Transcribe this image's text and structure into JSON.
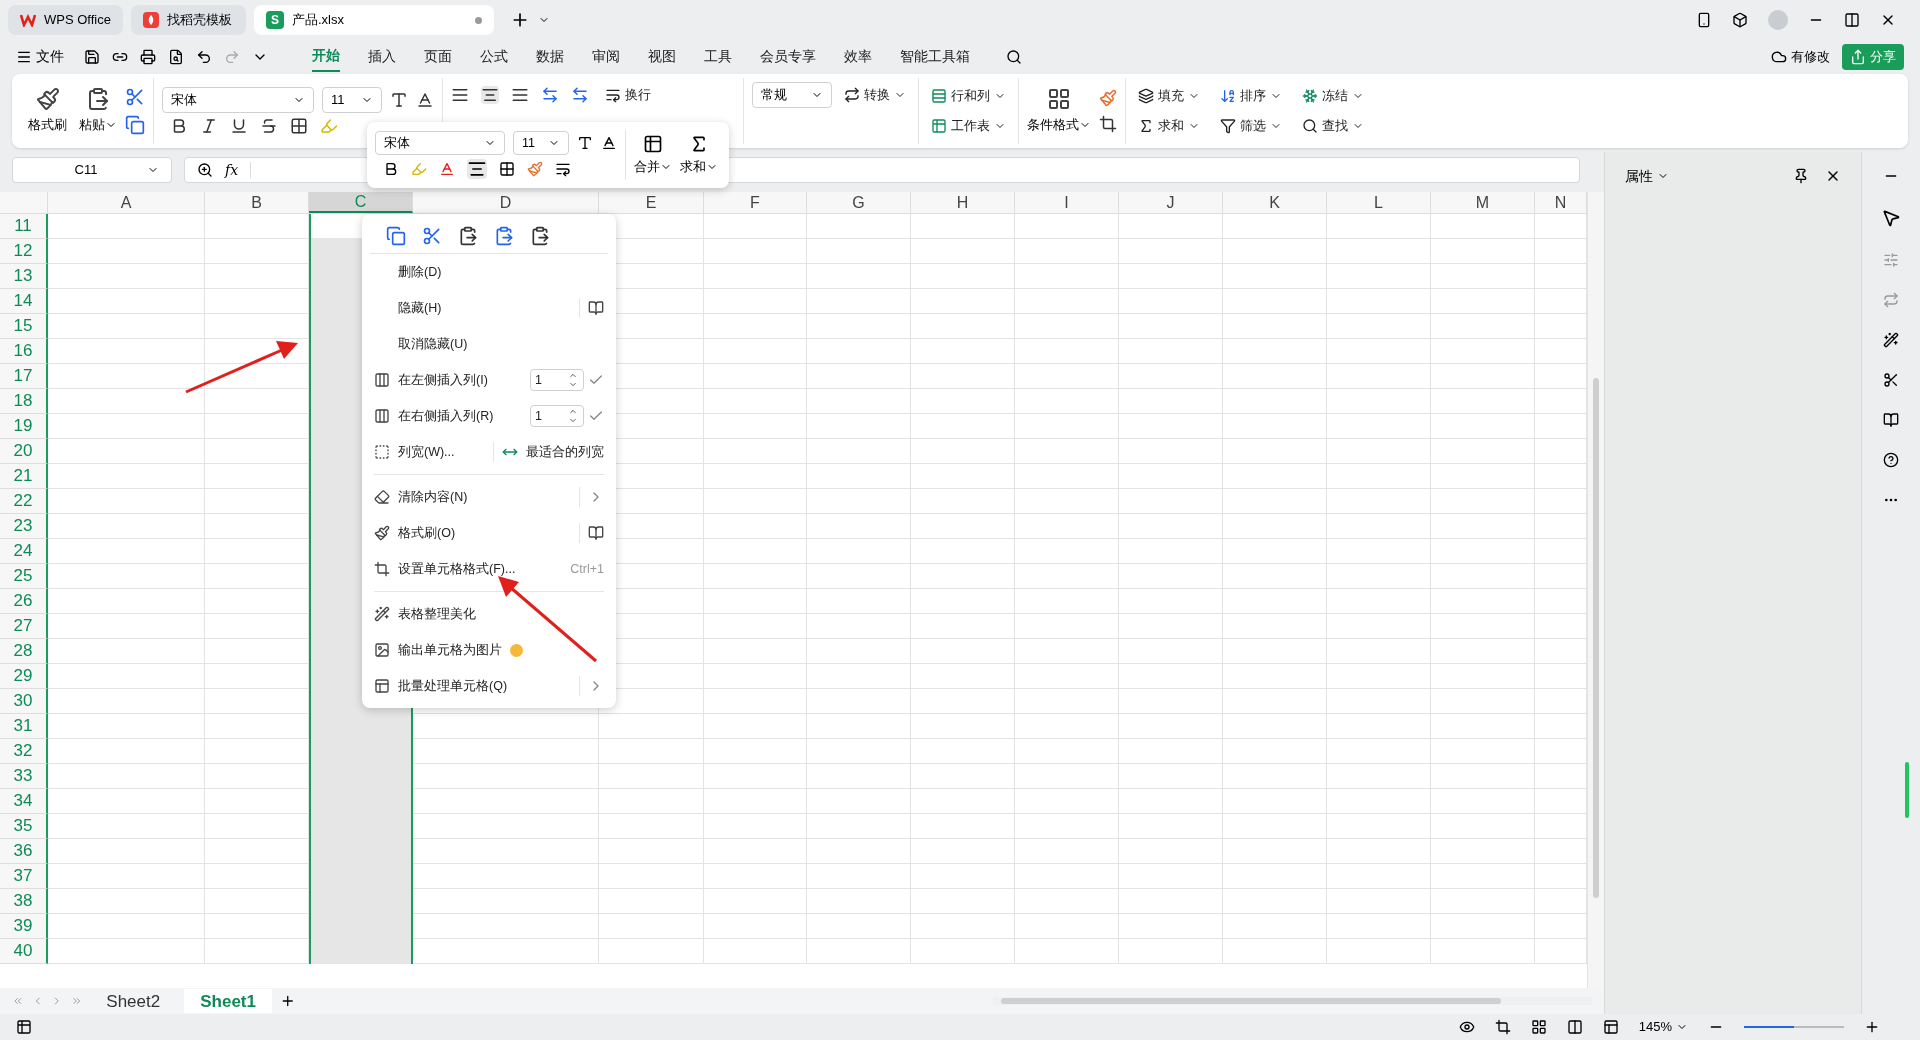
{
  "title_tabs": [
    {
      "label": "WPS Office",
      "selected": false,
      "kind": "wps"
    },
    {
      "label": "找稻壳模板",
      "selected": false,
      "kind": "docer"
    },
    {
      "label": "产品.xlsx",
      "selected": true,
      "kind": "sheet",
      "badge": "S",
      "unsaved": true
    }
  ],
  "menu": {
    "file": "文件",
    "tabs": [
      {
        "label": "开始",
        "selected": true
      },
      {
        "label": "插入",
        "selected": false
      },
      {
        "label": "页面",
        "selected": false
      },
      {
        "label": "公式",
        "selected": false
      },
      {
        "label": "数据",
        "selected": false
      },
      {
        "label": "审阅",
        "selected": false
      },
      {
        "label": "视图",
        "selected": false
      },
      {
        "label": "工具",
        "selected": false
      },
      {
        "label": "会员专享",
        "selected": false
      },
      {
        "label": "效率",
        "selected": false
      },
      {
        "label": "智能工具箱",
        "selected": false
      }
    ]
  },
  "cloud_status": "有修改",
  "share": "分享",
  "ribbon": {
    "format_painter": "格式刷",
    "paste": "粘贴",
    "font": "宋体",
    "font_size": "11",
    "wrap": "换行",
    "number_format": "常规",
    "convert": "转换",
    "rows_cols": "行和列",
    "worksheet": "工作表",
    "conditional": "条件格式",
    "fill": "填充",
    "sort": "排序",
    "freeze": "冻结",
    "sum": "求和",
    "filter": "筛选",
    "find": "查找"
  },
  "name_box": "C11",
  "fx": "fx",
  "columns": [
    {
      "label": "A",
      "selected": false
    },
    {
      "label": "B",
      "selected": false
    },
    {
      "label": "C",
      "selected": true
    },
    {
      "label": "D",
      "selected": false
    },
    {
      "label": "E",
      "selected": false
    },
    {
      "label": "F",
      "selected": false
    },
    {
      "label": "G",
      "selected": false
    },
    {
      "label": "H",
      "selected": false
    },
    {
      "label": "I",
      "selected": false
    },
    {
      "label": "J",
      "selected": false
    },
    {
      "label": "K",
      "selected": false
    },
    {
      "label": "L",
      "selected": false
    },
    {
      "label": "M",
      "selected": false
    },
    {
      "label": "N",
      "selected": false
    }
  ],
  "rows": [
    "11",
    "12",
    "13",
    "14",
    "15",
    "16",
    "17",
    "18",
    "19",
    "20",
    "21",
    "22",
    "23",
    "24",
    "25",
    "26",
    "27",
    "28",
    "29",
    "30",
    "31",
    "32",
    "33",
    "34",
    "35",
    "36",
    "37",
    "38",
    "39",
    "40"
  ],
  "mini_toolbar": {
    "font": "宋体",
    "size": "11",
    "merge": "合并",
    "sum": "求和"
  },
  "context_menu": [
    {
      "kind": "plain",
      "label": "删除(D)"
    },
    {
      "kind": "side_icon",
      "label": "隐藏(H)"
    },
    {
      "kind": "plain",
      "label": "取消隐藏(U)"
    },
    {
      "kind": "insert",
      "label": "在左侧插入列(I)",
      "count": "1"
    },
    {
      "kind": "insert",
      "label": "在右侧插入列(R)",
      "count": "1"
    },
    {
      "kind": "split",
      "label": "列宽(W)...",
      "right_label": "最适合的列宽"
    },
    {
      "kind": "separator"
    },
    {
      "kind": "submenu",
      "label": "清除内容(N)"
    },
    {
      "kind": "side_icon",
      "label": "格式刷(O)"
    },
    {
      "kind": "shortcut",
      "label": "设置单元格格式(F)...",
      "shortcut": "Ctrl+1"
    },
    {
      "kind": "separator"
    },
    {
      "kind": "plain",
      "label": "表格整理美化"
    },
    {
      "kind": "premium",
      "label": "输出单元格为图片"
    },
    {
      "kind": "submenu",
      "label": "批量处理单元格(Q)"
    }
  ],
  "panel": {
    "title": "属性"
  },
  "sheet_tabs": [
    {
      "label": "Sheet2",
      "selected": false
    },
    {
      "label": "Sheet1",
      "selected": true
    }
  ],
  "zoom": "145%",
  "zoom_slider": {
    "level": 0.5
  }
}
